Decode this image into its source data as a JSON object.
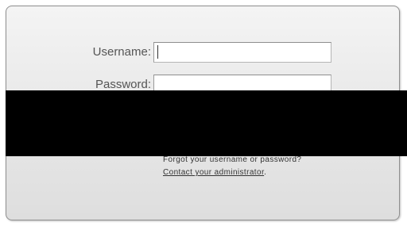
{
  "login": {
    "username_label": "Username:",
    "username_value": "",
    "password_label": "Password:",
    "password_value": "",
    "forgot_text": "Forgot your username or password?",
    "contact_link": "Contact your administrator",
    "contact_suffix": "."
  }
}
